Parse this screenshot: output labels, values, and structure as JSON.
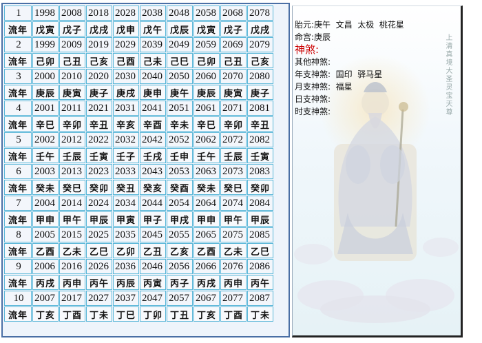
{
  "grid": {
    "row_label_liunian": "流年",
    "rows": [
      {
        "num": "1",
        "years": [
          "1998",
          "2008",
          "2018",
          "2028",
          "2038",
          "2048",
          "2058",
          "2068",
          "2078"
        ],
        "ganzhi": [
          "戊寅",
          "戊子",
          "戊戌",
          "戊申",
          "戊午",
          "戊辰",
          "戊寅",
          "戊子",
          "戊戌"
        ]
      },
      {
        "num": "2",
        "years": [
          "1999",
          "2009",
          "2019",
          "2029",
          "2039",
          "2049",
          "2059",
          "2069",
          "2079"
        ],
        "ganzhi": [
          "己卯",
          "己丑",
          "己亥",
          "己酉",
          "己未",
          "己巳",
          "己卯",
          "己丑",
          "己亥"
        ]
      },
      {
        "num": "3",
        "years": [
          "2000",
          "2010",
          "2020",
          "2030",
          "2040",
          "2050",
          "2060",
          "2070",
          "2080"
        ],
        "ganzhi": [
          "庚辰",
          "庚寅",
          "庚子",
          "庚戌",
          "庚申",
          "庚午",
          "庚辰",
          "庚寅",
          "庚子"
        ]
      },
      {
        "num": "4",
        "years": [
          "2001",
          "2011",
          "2021",
          "2031",
          "2041",
          "2051",
          "2061",
          "2071",
          "2081"
        ],
        "ganzhi": [
          "辛巳",
          "辛卯",
          "辛丑",
          "辛亥",
          "辛酉",
          "辛未",
          "辛巳",
          "辛卯",
          "辛丑"
        ]
      },
      {
        "num": "5",
        "years": [
          "2002",
          "2012",
          "2022",
          "2032",
          "2042",
          "2052",
          "2062",
          "2072",
          "2082"
        ],
        "ganzhi": [
          "壬午",
          "壬辰",
          "壬寅",
          "壬子",
          "壬戌",
          "壬申",
          "壬午",
          "壬辰",
          "壬寅"
        ]
      },
      {
        "num": "6",
        "years": [
          "2003",
          "2013",
          "2023",
          "2033",
          "2043",
          "2053",
          "2063",
          "2073",
          "2083"
        ],
        "ganzhi": [
          "癸未",
          "癸巳",
          "癸卯",
          "癸丑",
          "癸亥",
          "癸酉",
          "癸未",
          "癸巳",
          "癸卯"
        ]
      },
      {
        "num": "7",
        "years": [
          "2004",
          "2014",
          "2024",
          "2034",
          "2044",
          "2054",
          "2064",
          "2074",
          "2084"
        ],
        "ganzhi": [
          "甲申",
          "甲午",
          "甲辰",
          "甲寅",
          "甲子",
          "甲戌",
          "甲申",
          "甲午",
          "甲辰"
        ]
      },
      {
        "num": "8",
        "years": [
          "2005",
          "2015",
          "2025",
          "2035",
          "2045",
          "2055",
          "2065",
          "2075",
          "2085"
        ],
        "ganzhi": [
          "乙酉",
          "乙未",
          "乙巳",
          "乙卯",
          "乙丑",
          "乙亥",
          "乙酉",
          "乙未",
          "乙巳"
        ]
      },
      {
        "num": "9",
        "years": [
          "2006",
          "2016",
          "2026",
          "2036",
          "2046",
          "2056",
          "2066",
          "2076",
          "2086"
        ],
        "ganzhi": [
          "丙戌",
          "丙申",
          "丙午",
          "丙辰",
          "丙寅",
          "丙子",
          "丙戌",
          "丙申",
          "丙午"
        ]
      },
      {
        "num": "10",
        "years": [
          "2007",
          "2017",
          "2027",
          "2037",
          "2047",
          "2057",
          "2067",
          "2077",
          "2087"
        ],
        "ganzhi": [
          "丁亥",
          "丁酉",
          "丁未",
          "丁巳",
          "丁卯",
          "丁丑",
          "丁亥",
          "丁酉",
          "丁未"
        ]
      }
    ]
  },
  "info": {
    "taiyuan": "胎元:庚午  文昌  太极  桃花星",
    "minggong": "命宫:庚辰",
    "shensha_title": "神煞:",
    "qita": "其他神煞:",
    "nianzhi": "年支神煞:  国印  驿马星",
    "yuezhi": "月支神煞:  福星",
    "rizhi": "日支神煞:",
    "shizhi": "时支神煞:",
    "vertical_caption": "上清真境大圣灵宝天尊"
  }
}
